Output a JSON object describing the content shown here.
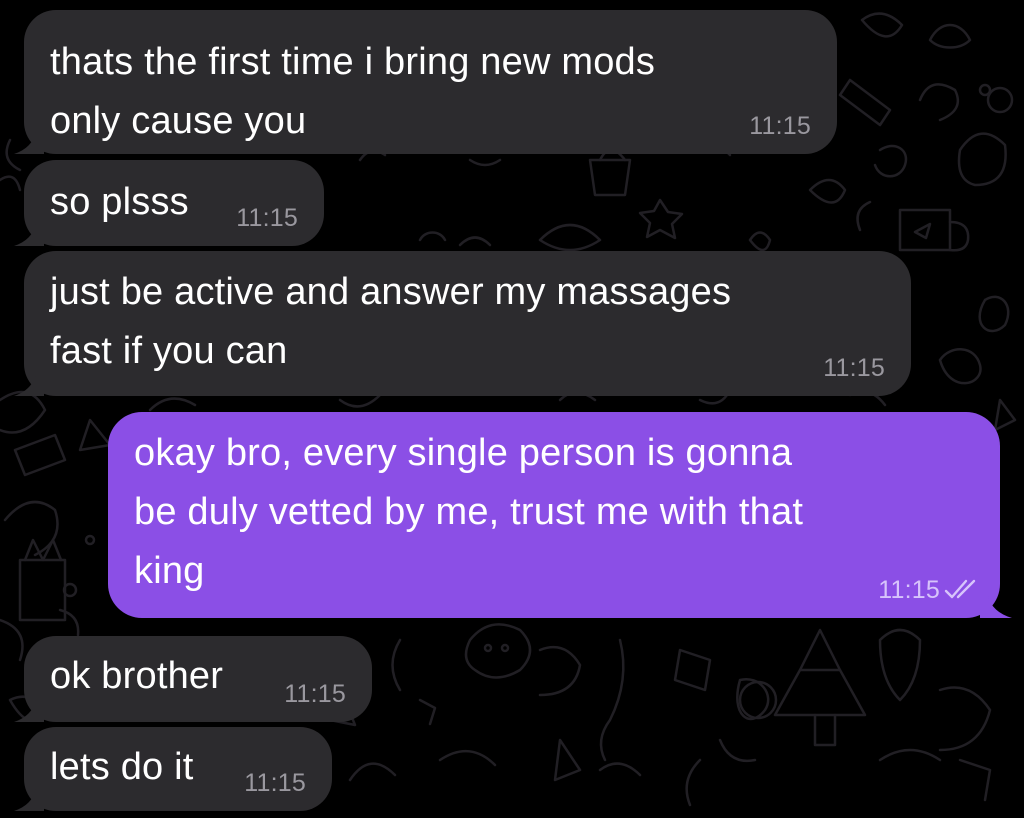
{
  "chat": {
    "messages": [
      {
        "direction": "incoming",
        "text": "thats the first time i bring new mods\nonly cause you",
        "time": "11:15"
      },
      {
        "direction": "incoming",
        "text": "so plsss",
        "time": "11:15"
      },
      {
        "direction": "incoming",
        "text": "just be active and answer my massages\nfast if you can",
        "time": "11:15"
      },
      {
        "direction": "outgoing",
        "text": "okay bro, every single person is gonna\nbe duly vetted by me, trust me with that\nking",
        "time": "11:15",
        "status": "read",
        "status_icon": "double-check-icon"
      },
      {
        "direction": "incoming",
        "text": "ok brother",
        "time": "11:15"
      },
      {
        "direction": "incoming",
        "text": "lets do it",
        "time": "11:15"
      }
    ]
  },
  "colors": {
    "background": "#000000",
    "incoming_bubble": "#2c2b2e",
    "outgoing_bubble": "#8b4fe6",
    "text": "#ffffff",
    "incoming_time": "#9a989f",
    "outgoing_time": "#d7c4fb",
    "wallpaper_doodle": "#1f1d22"
  }
}
